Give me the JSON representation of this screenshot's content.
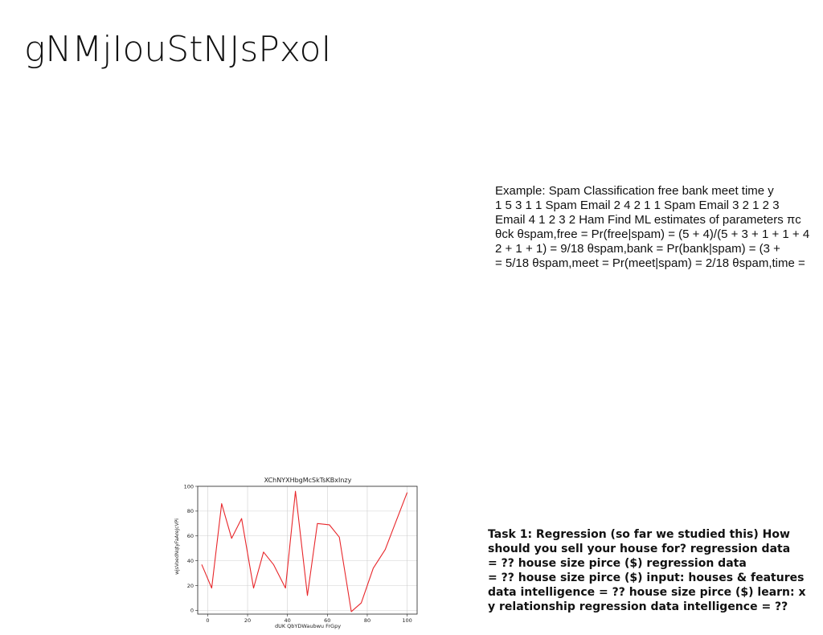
{
  "slide": {
    "title": "gNMjIouStNJsPxoI",
    "example_lines": [
      "Example: Spam Classification free bank meet time y",
      "1 5 3 1 1 Spam Email 2 4 2 1 1 Spam Email 3 2 1 2 3",
      "Email 4 1 2 3 2 Ham Find ML estimates of parameters πc",
      "θck θspam,free = Pr(free|spam) = (5 + 4)/(5 + 3 + 1 + 1 + 4",
      "2 + 1 + 1) = 9/18 θspam,bank = Pr(bank|spam) = (3 +",
      "= 5/18 θspam,meet = Pr(meet|spam) = 2/18 θspam,time ="
    ],
    "task_lines": [
      "Task 1: Regression (so far we studied this) How",
      "should you sell your house for? regression data",
      "= ?? house size pirce ($) regression data",
      "= ?? house size pirce ($) input: houses & features",
      "data intelligence = ?? house size pirce ($) learn: x",
      "y relationship regression data intelligence = ??"
    ]
  },
  "chart_data": {
    "type": "line",
    "title": "XChNYXHbgMcSkTsKBxInzy",
    "xlabel": "dUK QbYDWaubwu FrGpy",
    "ylabel": "wjsVoedNqtyFaAreJcVPi",
    "xlim": [
      -5,
      105
    ],
    "ylim": [
      -3,
      100
    ],
    "xticks": [
      0,
      20,
      40,
      60,
      80,
      100
    ],
    "yticks": [
      0,
      20,
      40,
      60,
      80,
      100
    ],
    "grid": true,
    "line_color": "#e8262a",
    "x": [
      -3,
      2,
      7,
      12,
      17,
      23,
      28,
      33,
      39,
      44,
      50,
      55,
      61,
      66,
      72,
      77,
      83,
      89,
      94,
      100
    ],
    "y": [
      37,
      18,
      86,
      58,
      74,
      18,
      47,
      37,
      18,
      96,
      12,
      70,
      69,
      59,
      -1,
      6,
      34,
      49,
      70,
      95
    ]
  }
}
